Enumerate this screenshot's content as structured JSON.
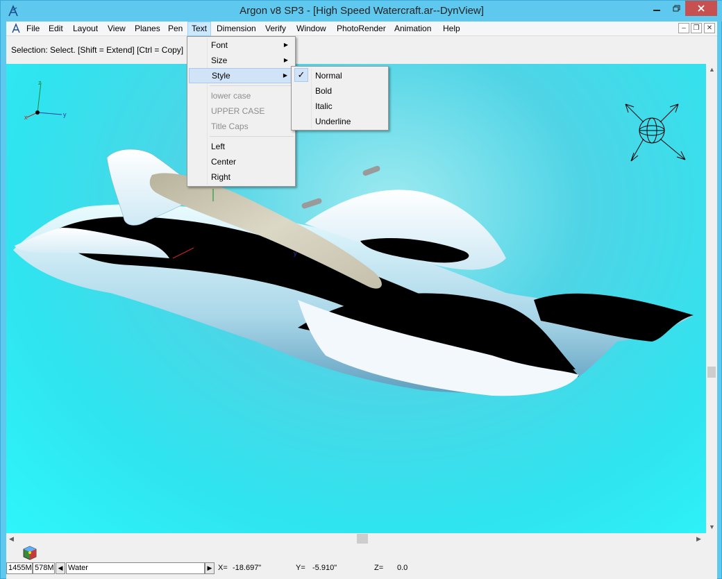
{
  "window": {
    "title": "Argon v8 SP3 - [High Speed Watercraft.ar--DynView]"
  },
  "menubar": {
    "items": [
      "File",
      "Edit",
      "Layout",
      "View",
      "Planes",
      "Pen",
      "Text",
      "Dimension",
      "Verify",
      "Window",
      "PhotoRender",
      "Animation",
      "Help"
    ],
    "active": "Text"
  },
  "selection_hint": "Selection: Select. [Shift = Extend] [Ctrl = Copy]",
  "text_menu": {
    "items": [
      {
        "label": "Font",
        "submenu": true,
        "enabled": true
      },
      {
        "label": "Size",
        "submenu": true,
        "enabled": true
      },
      {
        "label": "Style",
        "submenu": true,
        "enabled": true,
        "highlighted": true
      },
      {
        "label": "lower case",
        "enabled": false
      },
      {
        "label": "UPPER CASE",
        "enabled": false
      },
      {
        "label": "Title  Caps",
        "enabled": false
      },
      {
        "label": "Left",
        "enabled": true
      },
      {
        "label": "Center",
        "enabled": true
      },
      {
        "label": "Right",
        "enabled": true
      }
    ]
  },
  "style_submenu": {
    "items": [
      {
        "label": "Normal",
        "checked": true
      },
      {
        "label": "Bold",
        "checked": false
      },
      {
        "label": "Italic",
        "checked": false
      },
      {
        "label": "Underline",
        "checked": false
      }
    ]
  },
  "viewport": {
    "axis_labels": {
      "x": "x",
      "y": "y",
      "z": "z"
    },
    "model_axis_label": "y",
    "background_colors": {
      "top": "#4fd4e6",
      "bottom": "#2ef6fb"
    }
  },
  "status": {
    "mem1": "1455M",
    "mem2": "578M",
    "layer": "Water",
    "x_label": "X=",
    "x_value": "-18.697\"",
    "y_label": "Y=",
    "y_value": "-5.910\"",
    "z_label": "Z=",
    "z_value": "0.0"
  }
}
